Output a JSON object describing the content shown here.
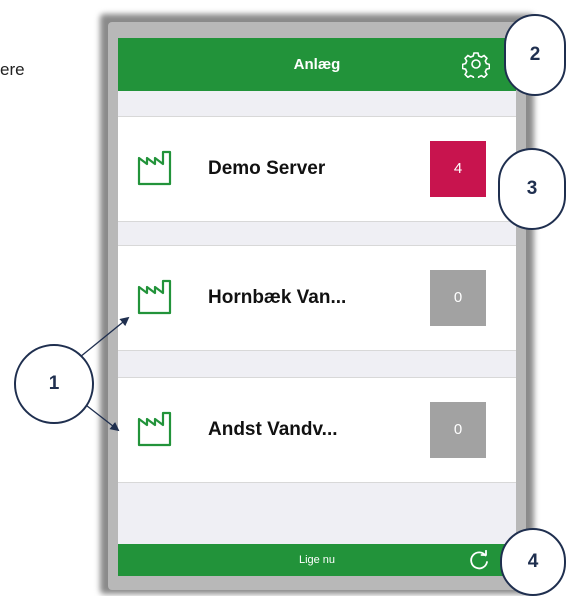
{
  "side_text": "ere",
  "nav": {
    "title": "Anlæg",
    "settings_icon": "gear-icon"
  },
  "rows": [
    {
      "label": "Demo Server",
      "count": "4",
      "badge_color": "#c8144e",
      "icon": "factory-icon"
    },
    {
      "label": "Hornbæk Van...",
      "count": "0",
      "badge_color": "#a2a2a2",
      "icon": "factory-icon"
    },
    {
      "label": "Andst Vandv...",
      "count": "0",
      "badge_color": "#a2a2a2",
      "icon": "factory-icon"
    }
  ],
  "toolbar": {
    "status": "Lige nu",
    "refresh_icon": "refresh-icon"
  },
  "callouts": {
    "c1": "1",
    "c2": "2",
    "c3": "3",
    "c4": "4"
  },
  "colors": {
    "accent": "#22933a",
    "alert": "#c8144e",
    "neutral_badge": "#a2a2a2",
    "callout": "#1f2f4f"
  }
}
